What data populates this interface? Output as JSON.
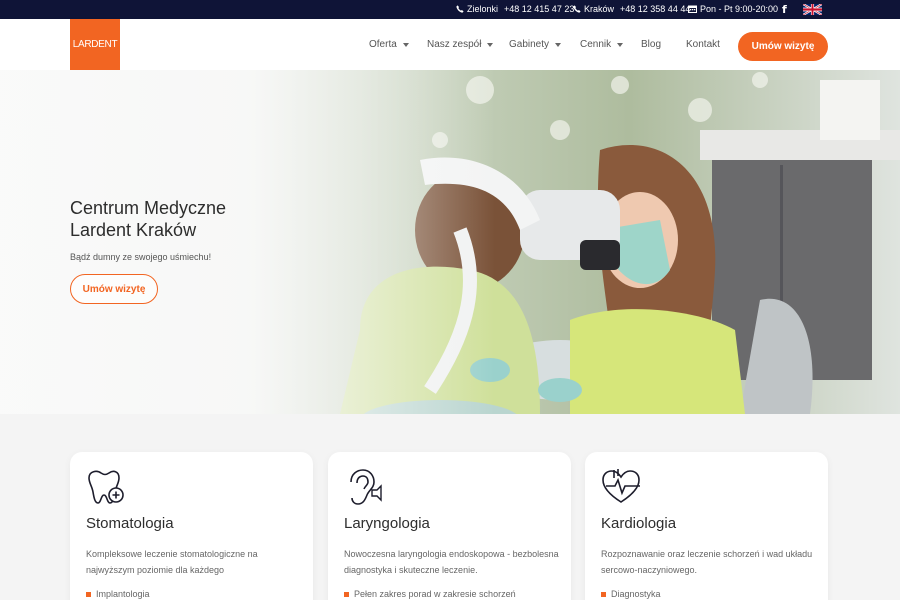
{
  "topbar": {
    "zielonki_city": "Zielonki",
    "zielonki_phone": "+48 12 415 47 23",
    "krakow_city": "Kraków",
    "krakow_phone": "+48 12 358 44 44",
    "hours": "Pon - Pt 9:00-20:00",
    "facebook": "f",
    "language_icon": "uk-flag-icon"
  },
  "nav": {
    "logo": "LARDENT",
    "items": [
      {
        "label": "Oferta",
        "dropdown": true
      },
      {
        "label": "Nasz zespół",
        "dropdown": true
      },
      {
        "label": "Gabinety",
        "dropdown": true
      },
      {
        "label": "Cennik",
        "dropdown": true
      },
      {
        "label": "Blog",
        "dropdown": false
      },
      {
        "label": "Kontakt",
        "dropdown": false
      }
    ],
    "cta": "Umów wizytę"
  },
  "hero": {
    "title_line1": "Centrum Medyczne",
    "title_line2": "Lardent Kraków",
    "subtitle": "Bądź dumny ze swojego uśmiechu!",
    "button": "Umów wizytę"
  },
  "cards": [
    {
      "icon": "tooth-icon",
      "title": "Stomatologia",
      "description": "Kompleksowe leczenie stomatologiczne na najwyższym poziomie dla każdego",
      "bullet": "Implantologia"
    },
    {
      "icon": "ear-icon",
      "title": "Laryngologia",
      "description": "Nowoczesna laryngologia endoskopowa - bezbolesna diagnostyka i skuteczne leczenie.",
      "bullet": "Pełen zakres porad w zakresie schorzeń"
    },
    {
      "icon": "heart-icon",
      "title": "Kardiologia",
      "description": "Rozpoznawanie oraz leczenie schorzeń i wad układu sercowo-naczyniowego.",
      "bullet": "Diagnostyka"
    }
  ],
  "colors": {
    "accent": "#f26522",
    "topbar": "#0f1437"
  }
}
